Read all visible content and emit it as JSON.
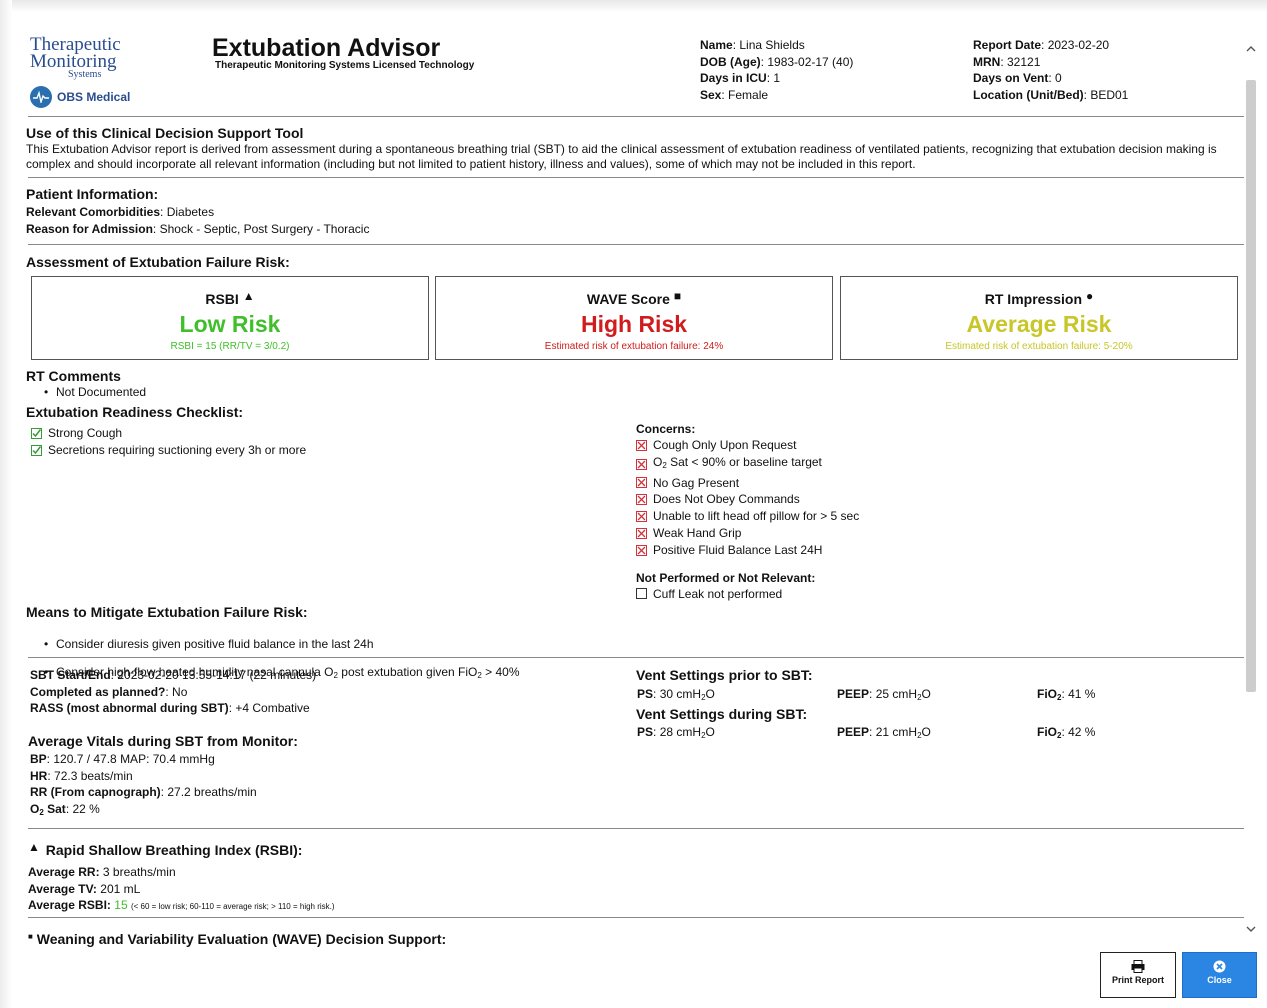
{
  "brand": {
    "logo_line1": "Therapeutic",
    "logo_line2": "Monitoring",
    "logo_line3": "Systems",
    "obs_label": "OBS Medical"
  },
  "header": {
    "title": "Extubation Advisor",
    "subtitle": "Therapeutic Monitoring Systems Licensed Technology"
  },
  "patient": {
    "name_label": "Name",
    "name": "Lina Shields",
    "dob_label": "DOB (Age)",
    "dob": "1983-02-17  (40)",
    "icu_label": "Days in ICU",
    "icu": "1",
    "sex_label": "Sex",
    "sex": "Female",
    "report_date_label": "Report Date",
    "report_date": "2023-02-20",
    "mrn_label": "MRN",
    "mrn": "32121",
    "vent_days_label": "Days on Vent",
    "vent_days": "0",
    "location_label": "Location (Unit/Bed)",
    "location": "BED01"
  },
  "use_section": {
    "title": "Use of this Clinical Decision Support Tool",
    "body": "This Extubation Advisor report is derived from assessment during a spontaneous breathing trial (SBT) to aid the clinical assessment of extubation readiness of ventilated patients, recognizing that extubation decision making is complex and should incorporate all relevant information (including but not limited to patient history, illness and values), some of which may not be included in this report."
  },
  "patient_info": {
    "title": "Patient Information:",
    "comorb_label": "Relevant Comorbidities",
    "comorb": "Diabetes",
    "admission_label": "Reason for Admission",
    "admission": "Shock - Septic, Post Surgery - Thoracic"
  },
  "assessment": {
    "title": "Assessment of Extubation Failure Risk:",
    "rsbi": {
      "label": "RSBI",
      "marker": "▲",
      "risk": "Low Risk",
      "note": "RSBI = 15 (RR/TV = 3/0.2)"
    },
    "wave": {
      "label": "WAVE Score",
      "marker": "■",
      "risk": "High Risk",
      "note": "Estimated risk of extubation failure: 24%"
    },
    "rt": {
      "label": "RT Impression",
      "marker": "●",
      "risk": "Average Risk",
      "note": "Estimated risk of extubation failure: 5-20%"
    }
  },
  "rt_comments": {
    "title": "RT Comments",
    "items": [
      "Not Documented"
    ]
  },
  "checklist": {
    "title": "Extubation Readiness Checklist:",
    "ok": [
      "Strong Cough",
      "Secretions requiring suctioning every 3h or more"
    ],
    "concerns_title": "Concerns:",
    "concerns": [
      "Cough Only Upon Request",
      "No Gag Present",
      "Does Not Obey Commands",
      "Unable to lift head off pillow for > 5 sec",
      "Weak Hand Grip",
      "Positive Fluid Balance Last 24H"
    ],
    "o2_prefix": "O",
    "o2_sub": "2",
    "o2_rest": " Sat < 90% or baseline target",
    "np_title": "Not Performed or Not Relevant:",
    "np": [
      "Cuff Leak not performed"
    ]
  },
  "mitigate": {
    "title": "Means to Mitigate Extubation Failure Risk:",
    "item1": "Consider diuresis given positive fluid balance in the last 24h",
    "item2_a": "Consider high-flow heated humidity nasal cannula O",
    "item2_b": " post extubation given FiO",
    "item2_c": " > 40%",
    "sub2": "2"
  },
  "sbt": {
    "start_label": "SBT Start/End",
    "start": "2023-02-20 13:55-14:17 (22 minutes)",
    "completed_label": "Completed as planned?",
    "completed": "No",
    "rass_label": "RASS (most abnormal during SBT)",
    "rass": "+4 Combative"
  },
  "vitals": {
    "title": "Average Vitals during SBT from Monitor:",
    "bp_label": "BP",
    "bp": "120.7 / 47.8 MAP: 70.4 mmHg",
    "hr_label": "HR",
    "hr": "72.3 beats/min",
    "rr_label": "RR (From capnograph)",
    "rr": "27.2 breaths/min",
    "o2_label": "O",
    "o2_sub": "2",
    "o2_label_rest": " Sat",
    "o2": "22 %"
  },
  "vent": {
    "prior_title": "Vent Settings prior to SBT:",
    "during_title": "Vent Settings during SBT:",
    "ps_label": "PS",
    "peep_label": "PEEP",
    "fio_label": "FiO",
    "fio_sub": "2",
    "unit_a": "cmH",
    "unit_sub": "2",
    "unit_b": "O",
    "prior_ps": "30",
    "prior_peep": "25",
    "prior_fio": "41 %",
    "during_ps": "28",
    "during_peep": "21",
    "during_fio": "42 %"
  },
  "rsbi_section": {
    "marker": "▲",
    "title": "Rapid Shallow Breathing Index (RSBI):",
    "rr_label": "Average RR:",
    "rr": "3 breaths/min",
    "tv_label": "Average TV:",
    "tv": "201 mL",
    "rsbi_label": "Average RSBI:",
    "rsbi": "15",
    "rsbi_note": "(< 60 = low risk; 60-110 = average risk; > 110 = high risk.)"
  },
  "wave_section": {
    "marker": "■",
    "title": "Weaning and Variability Evaluation (WAVE) Decision Support:"
  },
  "buttons": {
    "print": "Print Report",
    "close": "Close"
  },
  "colors": {
    "low": "#3fbf2a",
    "high": "#d01c1c",
    "average": "#c8c628",
    "accent": "#2b86e3"
  }
}
